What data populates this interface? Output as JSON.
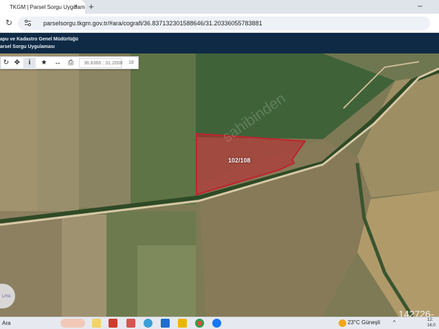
{
  "browser": {
    "tab_title": "TKGM | Parsel Sorgu Uygulaması",
    "tab_close": "×",
    "new_tab": "+",
    "minimize": "–",
    "reload": "↻",
    "url": "parselsorgu.tkgm.gov.tr/#ara/cografi/36.837132301588646/31.20336055783881"
  },
  "header": {
    "org_name": "apu ve Kadastro Genel Müdürlüğü",
    "app_name": "arsel Sorgu Uygulaması"
  },
  "map_toolbar": {
    "refresh_icon": "↻",
    "locate_icon": "✥",
    "info_icon": "i",
    "favorite_icon": "★",
    "measure_icon": "↔",
    "print_icon": "⎙",
    "coordinates": "36.8366 : 31.2008",
    "zoom_level": "18"
  },
  "map": {
    "parcel_label": "102/108",
    "watermark_number": "142726-",
    "badge_text": "LIYA",
    "parcel_color": "#c0222e"
  },
  "taskbar": {
    "search_label": "Ara",
    "weather": "23°C  Güneşli",
    "tray_chevron": "^",
    "time": "12:",
    "date": "16.0"
  }
}
